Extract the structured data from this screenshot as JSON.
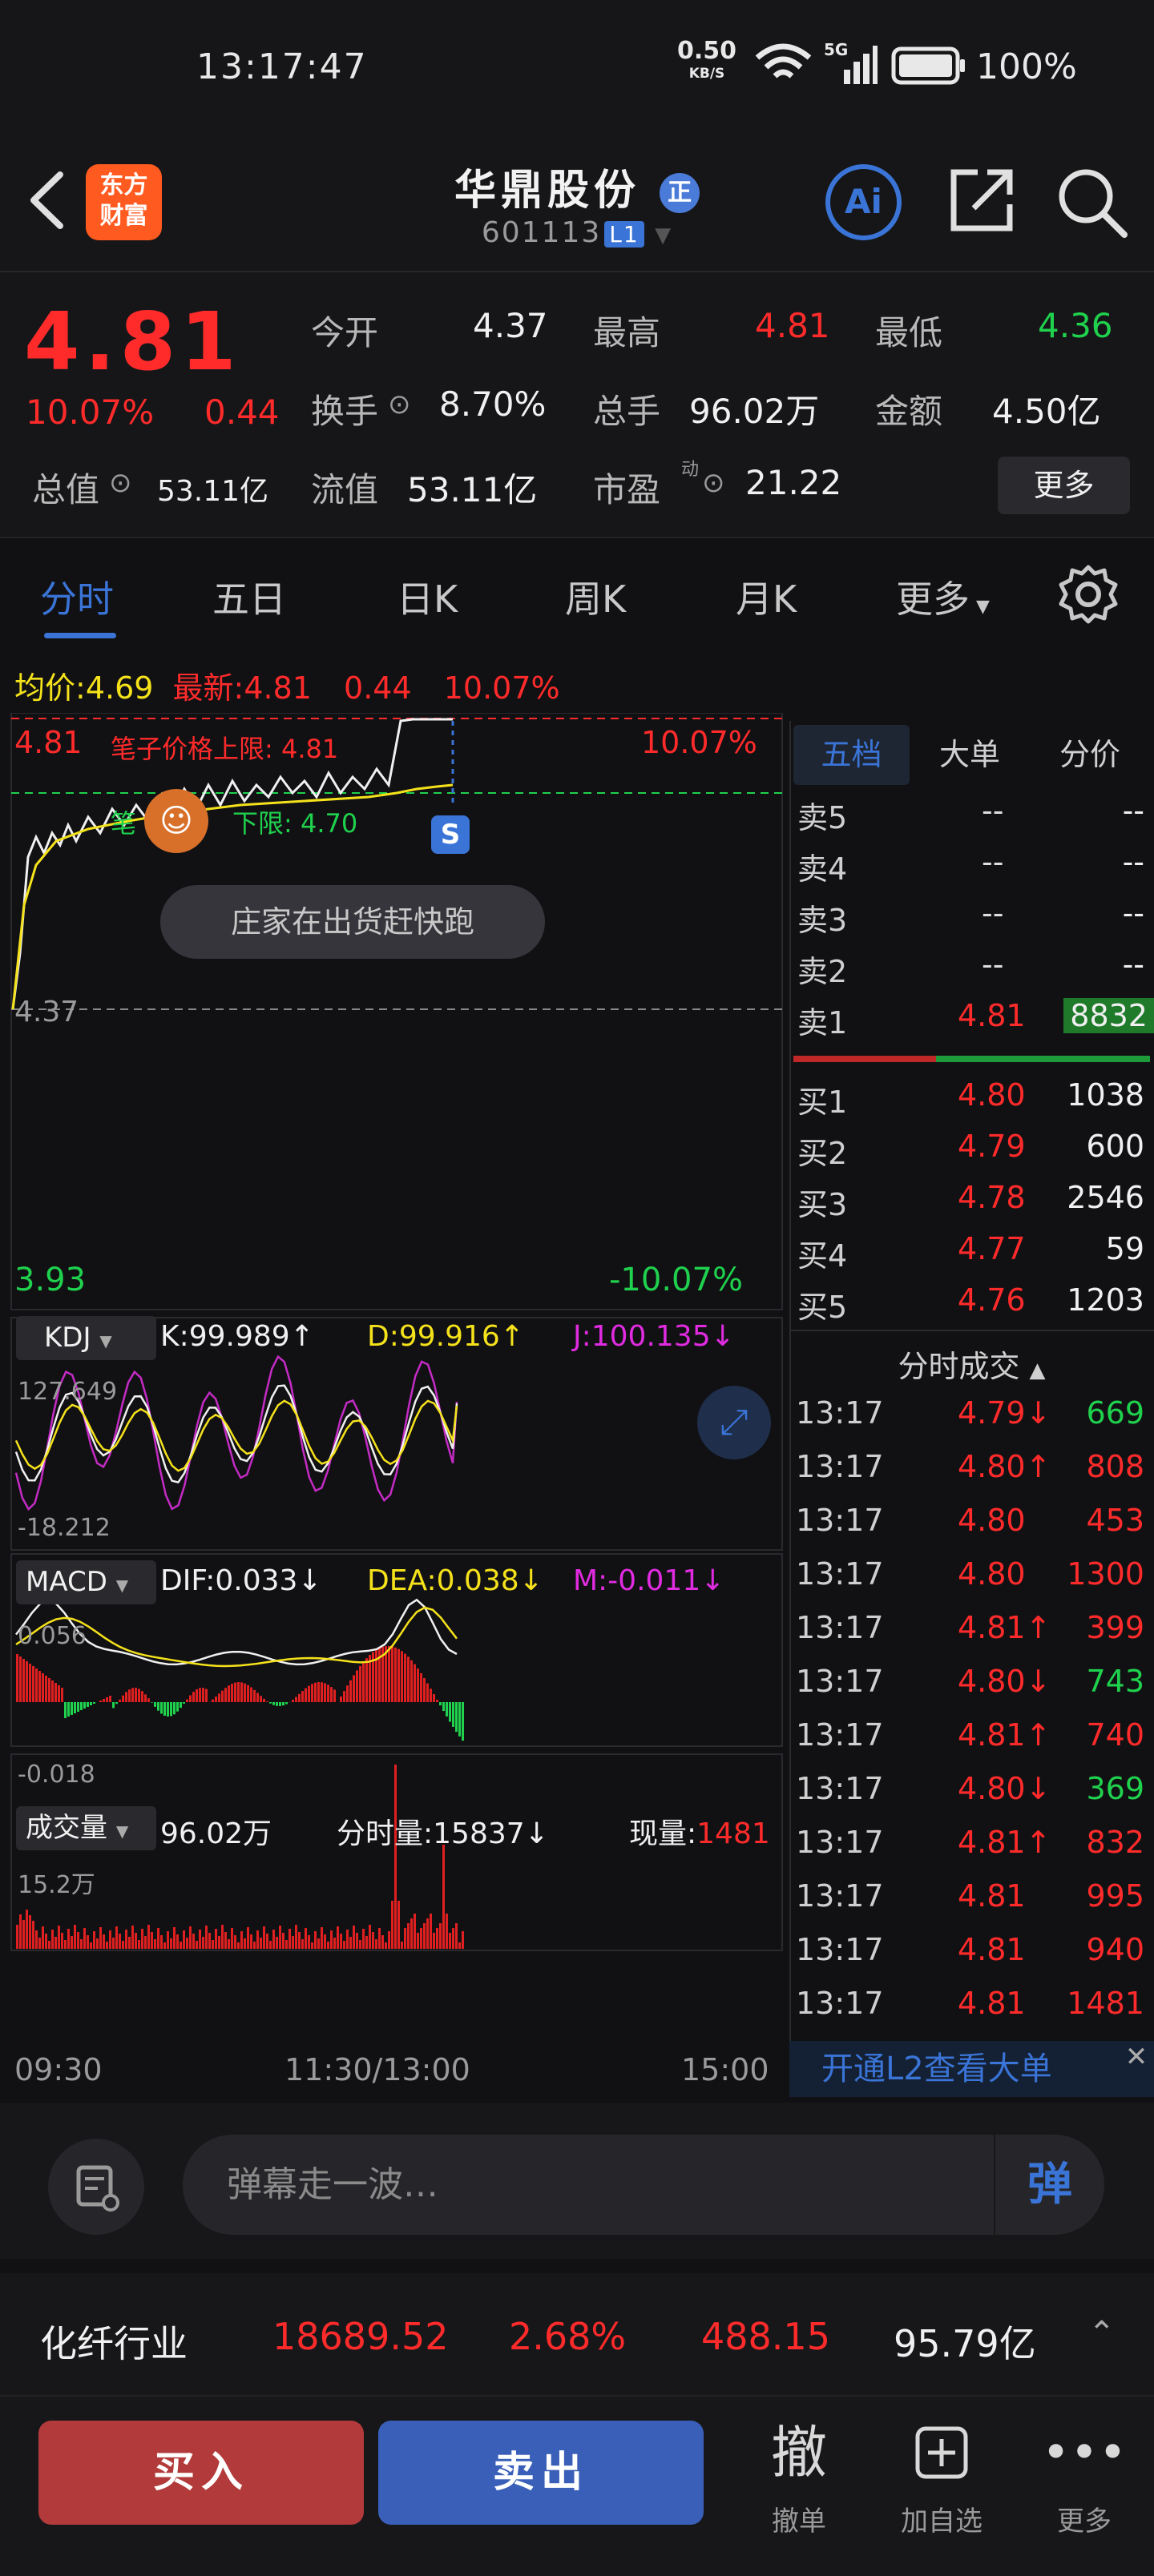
{
  "status_bar": {
    "time": "13:17:47",
    "net_speed": "0.50",
    "net_unit": "KB/S",
    "net_type": "5G",
    "battery": "100%"
  },
  "header": {
    "logo_line1": "东方",
    "logo_line2": "财富",
    "title": "华鼎股份",
    "title_badge": "正",
    "code": "601113",
    "code_tag": "L1",
    "ai_label": "Ai"
  },
  "quote": {
    "price": "4.81",
    "change_pct": "10.07%",
    "change_amt": "0.44",
    "open_label": "今开",
    "open": "4.37",
    "high_label": "最高",
    "high": "4.81",
    "low_label": "最低",
    "low": "4.36",
    "turnover_label": "换手",
    "turnover": "8.70%",
    "volume_label": "总手",
    "volume": "96.02万",
    "amount_label": "金额",
    "amount": "4.50亿",
    "mktcap_label": "总值",
    "mktcap": "53.11亿",
    "float_label": "流值",
    "float": "53.11亿",
    "pe_label": "市盈",
    "pe_sup": "动",
    "pe": "21.22",
    "more": "更多"
  },
  "tabs": [
    "分时",
    "五日",
    "日K",
    "周K",
    "月K",
    "更多"
  ],
  "chart": {
    "avg_label": "均价:",
    "avg": "4.69",
    "latest_label": "最新:",
    "latest": "4.81",
    "change_amt": "0.44",
    "change_pct": "10.07%",
    "price_top": "4.81",
    "upper_limit_note": "笔子价格上限: 4.81",
    "pct_top": "10.07%",
    "lower_limit_note_prefix": "笔",
    "lower_limit_note": "下限: 4.70",
    "base_price": "4.37",
    "price_bottom": "3.93",
    "pct_bottom": "-10.07%",
    "ad_pill": "庄家在出货赶快跑",
    "signal_marker": "S",
    "kdj_label": "KDJ",
    "kdj_k": "K:99.989↑",
    "kdj_d": "D:99.916↑",
    "kdj_j": "J:100.135↓",
    "kdj_top": "127.649",
    "kdj_bottom": "-18.212",
    "macd_label": "MACD",
    "macd_dif": "DIF:0.033↓",
    "macd_dea": "DEA:0.038↓",
    "macd_m": "M:-0.011↓",
    "macd_top": "0.056",
    "macd_bottom": "-0.018",
    "vol_label": "成交量",
    "vol_total": "96.02万",
    "vol_tick_label": "分时量:",
    "vol_tick": "15837↓",
    "vol_now_label": "现量:",
    "vol_now": "1481",
    "vol_top": "15.2万",
    "time_start": "09:30",
    "time_mid": "11:30/13:00",
    "time_end": "15:00"
  },
  "order_book": {
    "tabs": [
      "五档",
      "大单",
      "分价"
    ],
    "asks": [
      {
        "label": "卖5",
        "price": "--",
        "vol": "--"
      },
      {
        "label": "卖4",
        "price": "--",
        "vol": "--"
      },
      {
        "label": "卖3",
        "price": "--",
        "vol": "--"
      },
      {
        "label": "卖2",
        "price": "--",
        "vol": "--"
      },
      {
        "label": "卖1",
        "price": "4.81",
        "vol": "8832"
      }
    ],
    "bids": [
      {
        "label": "买1",
        "price": "4.80",
        "vol": "1038"
      },
      {
        "label": "买2",
        "price": "4.79",
        "vol": "600"
      },
      {
        "label": "买3",
        "price": "4.78",
        "vol": "2546"
      },
      {
        "label": "买4",
        "price": "4.77",
        "vol": "59"
      },
      {
        "label": "买5",
        "price": "4.76",
        "vol": "1203"
      }
    ],
    "trades_title": "分时成交",
    "trades": [
      {
        "time": "13:17",
        "price": "4.79↓",
        "vol": "669",
        "dir": "down"
      },
      {
        "time": "13:17",
        "price": "4.80↑",
        "vol": "808",
        "dir": "up"
      },
      {
        "time": "13:17",
        "price": "4.80",
        "vol": "453",
        "dir": "up"
      },
      {
        "time": "13:17",
        "price": "4.80",
        "vol": "1300",
        "dir": "up"
      },
      {
        "time": "13:17",
        "price": "4.81↑",
        "vol": "399",
        "dir": "up"
      },
      {
        "time": "13:17",
        "price": "4.80↓",
        "vol": "743",
        "dir": "down"
      },
      {
        "time": "13:17",
        "price": "4.81↑",
        "vol": "740",
        "dir": "up"
      },
      {
        "time": "13:17",
        "price": "4.80↓",
        "vol": "369",
        "dir": "down"
      },
      {
        "time": "13:17",
        "price": "4.81↑",
        "vol": "832",
        "dir": "up"
      },
      {
        "time": "13:17",
        "price": "4.81",
        "vol": "995",
        "dir": "up"
      },
      {
        "time": "13:17",
        "price": "4.81",
        "vol": "940",
        "dir": "up"
      },
      {
        "time": "13:17",
        "price": "4.81",
        "vol": "1481",
        "dir": "up"
      }
    ],
    "l2_banner": "开通L2查看大单"
  },
  "comment": {
    "placeholder": "弹幕走一波…",
    "send": "弹"
  },
  "industry": {
    "name": "化纤行业",
    "index": "18689.52",
    "pct": "2.68%",
    "chg": "488.15",
    "amount": "95.79亿"
  },
  "bottom": {
    "buy": "买入",
    "sell": "卖出",
    "cancel_icon": "撤",
    "cancel": "撤单",
    "watch": "加自选",
    "more": "更多"
  },
  "colors": {
    "up": "#ff2b2b",
    "down": "#1fd14d",
    "accent": "#3a74d6",
    "avg_line": "#f5e21b"
  }
}
